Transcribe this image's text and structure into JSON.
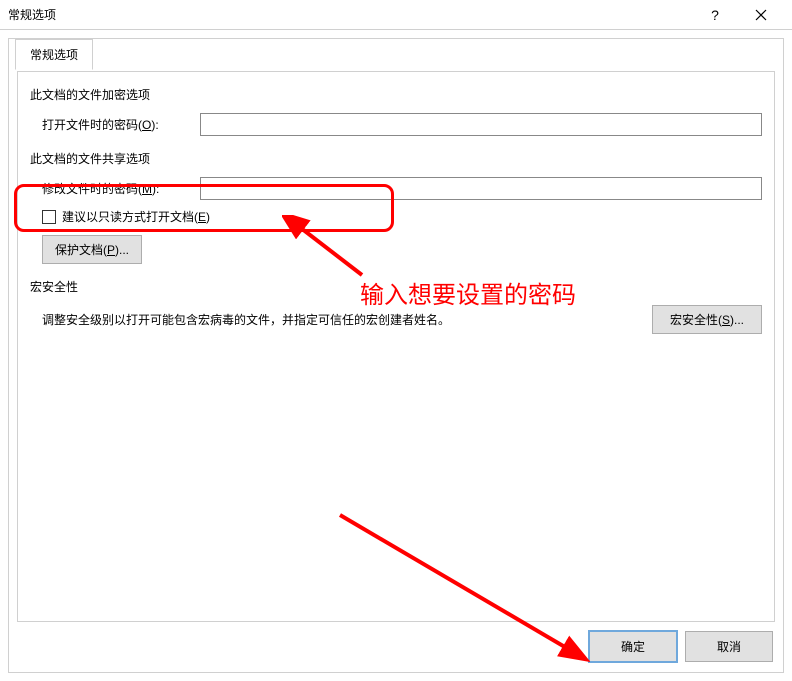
{
  "titlebar": {
    "title": "常规选项"
  },
  "tab": {
    "label": "常规选项"
  },
  "encrypt_section": {
    "title": "此文档的文件加密选项",
    "open_label_prefix": "打开文件时的密码(",
    "open_label_key": "O",
    "open_label_suffix": "):",
    "open_value": ""
  },
  "share_section": {
    "title": "此文档的文件共享选项",
    "modify_label_prefix": "修改文件时的密码(",
    "modify_label_key": "M",
    "modify_label_suffix": "):",
    "modify_value": "",
    "readonly_prefix": "建议以只读方式打开文档(",
    "readonly_key": "E",
    "readonly_suffix": ")",
    "protect_btn_prefix": "保护文档(",
    "protect_btn_key": "P",
    "protect_btn_suffix": ")..."
  },
  "macro_section": {
    "title": "宏安全性",
    "desc": "调整安全级别以打开可能包含宏病毒的文件，并指定可信任的宏创建者姓名。",
    "btn_prefix": "宏安全性(",
    "btn_key": "S",
    "btn_suffix": ")..."
  },
  "footer": {
    "ok": "确定",
    "cancel": "取消"
  },
  "annotation": {
    "text": "输入想要设置的密码"
  }
}
